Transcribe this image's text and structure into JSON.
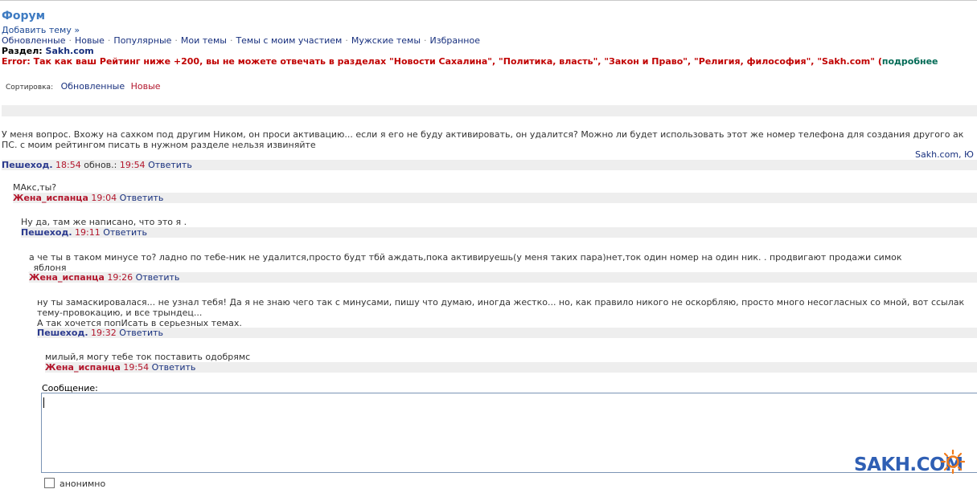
{
  "forum": {
    "title": "Форум",
    "add_topic": "Добавить тему »",
    "nav": [
      "Обновленные",
      "Новые",
      "Популярные",
      "Мои темы",
      "Темы с моим участием",
      "Мужские темы",
      "Избранное"
    ],
    "section_label": "Раздел:",
    "section_name": "Sakh.com",
    "error_main": "Error: Так как ваш Рейтинг ниже +200, вы не можете отвечать в разделах \"Новости Сахалина\", \"Политика, власть\", \"Закон и Право\", \"Религия, философия\", \"Sakh.com\" (",
    "error_more": "подробнее",
    "sort_label": "Сортировка:",
    "sort_options": [
      "Обновленные",
      "Новые"
    ]
  },
  "post": {
    "line1": "У меня вопрос. Вхожу на сахком под другим Ником, он проси активацию... если я его не буду активировать, он удалится? Можно ли будет использовать этот же номер телефона для создания другого ак",
    "line2": "ПС. с моим рейтингом писать в нужном разделе нельзя извиняйте",
    "tag": "Sakh.com, Ю",
    "author": "Пешеход.",
    "time": "18:54",
    "edited_label": "обнов.:",
    "edited_time": "19:54",
    "reply": "Ответить"
  },
  "replies": [
    {
      "lines": [
        "МАкс,ты?"
      ],
      "author": "Жена_испанца",
      "time": "19:04",
      "reply": "Ответить"
    },
    {
      "lines": [
        "Ну да, там же написано, что это я ."
      ],
      "author": "Пешеход.",
      "time": "19:11",
      "reply": "Ответить"
    },
    {
      "lines": [
        "а че ты в таком минусе то? ладно по тебе-ник не удалится,просто будт тбй аждать,пока активируешь(у меня таких пара)нет,ток один номер на один ник. . продвигают продажи симок",
        "_яблоня_"
      ],
      "author": "Жена_испанца",
      "time": "19:26",
      "reply": "Ответить"
    },
    {
      "lines": [
        "ну ты замаскировалася... не узнал тебя! Да я не знаю чего так с минусами, пишу что думаю, иногда жестко... но, как правило никого не оскорбляю, просто много несогласных со мной, вот ссылак",
        "тему-провокацию, и все трындец...",
        "А так хочется попИсать в серьезных темах."
      ],
      "author": "Пешеход.",
      "time": "19:32",
      "reply": "Ответить"
    },
    {
      "lines": [
        "милый,я могу тебе ток поставить одобрямс"
      ],
      "author": "Жена_испанца",
      "time": "19:54",
      "reply": "Ответить"
    }
  ],
  "form": {
    "message_label": "Сообщение:",
    "checkbox_label": "анонимно"
  },
  "logo": {
    "text": "SAKH.COM"
  },
  "colors": {
    "link": "#18307e",
    "title": "#3e7bc2",
    "error": "#c00000",
    "author_red": "#b2162c",
    "author_blue": "#2b3a8e",
    "meta_bg": "#eeeeee"
  }
}
